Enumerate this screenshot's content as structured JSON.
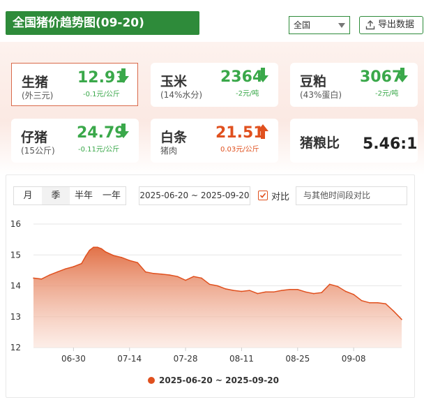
{
  "header": {
    "title": "全国猪价趋势图(09-20)",
    "region_select": "全国",
    "export_label": "导出数据"
  },
  "cards": [
    {
      "name": "生猪",
      "sub": "(外三元)",
      "price": "12.91",
      "change": "-0.1元/公斤",
      "direction": "down"
    },
    {
      "name": "玉米",
      "sub": "(14%水分)",
      "price": "2364",
      "change": "-2元/吨",
      "direction": "down"
    },
    {
      "name": "豆粕",
      "sub": "(43%蛋白)",
      "price": "3067",
      "change": "-2元/吨",
      "direction": "down"
    },
    {
      "name": "仔猪",
      "sub": "(15公斤)",
      "price": "24.79",
      "change": "-0.11元/公斤",
      "direction": "down"
    },
    {
      "name": "白条",
      "sub": "猪肉",
      "price": "21.51",
      "change": "0.03元/公斤",
      "direction": "up"
    },
    {
      "name": "猪粮比",
      "value": "5.46:1"
    }
  ],
  "controls": {
    "range_tabs": [
      "月",
      "季",
      "半年",
      "一年"
    ],
    "active_range": "季",
    "date_range": "2025-06-20 ~ 2025-09-20",
    "compare_label": "对比",
    "compare_placeholder": "与其他时间段对比"
  },
  "colors": {
    "brand_green": "#2e8b3a",
    "up_red": "#e0501e",
    "down_green": "#3aa84a",
    "series": "#e0501e"
  },
  "chart_data": {
    "type": "area",
    "ylim": [
      12,
      16
    ],
    "yticks": [
      12,
      13,
      14,
      15,
      16
    ],
    "xlim": [
      "2025-06-20",
      "2025-09-20"
    ],
    "xticks": [
      "06-30",
      "07-14",
      "07-28",
      "08-11",
      "08-25",
      "09-08"
    ],
    "xtick_dates": [
      "2025-06-30",
      "2025-07-14",
      "2025-07-28",
      "2025-08-11",
      "2025-08-25",
      "2025-09-08"
    ],
    "grid": true,
    "legend": "bottom",
    "series": [
      {
        "name": "2025-06-20 ~ 2025-09-20",
        "x": [
          "2025-06-20",
          "2025-06-22",
          "2025-06-24",
          "2025-06-26",
          "2025-06-28",
          "2025-06-30",
          "2025-07-02",
          "2025-07-03",
          "2025-07-04",
          "2025-07-05",
          "2025-07-06",
          "2025-07-07",
          "2025-07-08",
          "2025-07-10",
          "2025-07-12",
          "2025-07-14",
          "2025-07-16",
          "2025-07-18",
          "2025-07-20",
          "2025-07-22",
          "2025-07-24",
          "2025-07-26",
          "2025-07-28",
          "2025-07-30",
          "2025-08-01",
          "2025-08-03",
          "2025-08-05",
          "2025-08-07",
          "2025-08-09",
          "2025-08-11",
          "2025-08-13",
          "2025-08-15",
          "2025-08-17",
          "2025-08-19",
          "2025-08-21",
          "2025-08-23",
          "2025-08-25",
          "2025-08-27",
          "2025-08-29",
          "2025-08-31",
          "2025-09-02",
          "2025-09-04",
          "2025-09-06",
          "2025-09-08",
          "2025-09-10",
          "2025-09-12",
          "2025-09-14",
          "2025-09-16",
          "2025-09-18",
          "2025-09-20"
        ],
        "values": [
          14.25,
          14.22,
          14.35,
          14.45,
          14.55,
          14.62,
          14.72,
          14.95,
          15.15,
          15.25,
          15.25,
          15.2,
          15.1,
          14.98,
          14.92,
          14.82,
          14.75,
          14.45,
          14.4,
          14.38,
          14.35,
          14.3,
          14.18,
          14.3,
          14.25,
          14.05,
          14.0,
          13.9,
          13.85,
          13.82,
          13.85,
          13.75,
          13.8,
          13.8,
          13.85,
          13.88,
          13.88,
          13.8,
          13.75,
          13.78,
          14.05,
          13.98,
          13.82,
          13.72,
          13.52,
          13.45,
          13.45,
          13.42,
          13.18,
          12.91
        ]
      }
    ]
  }
}
